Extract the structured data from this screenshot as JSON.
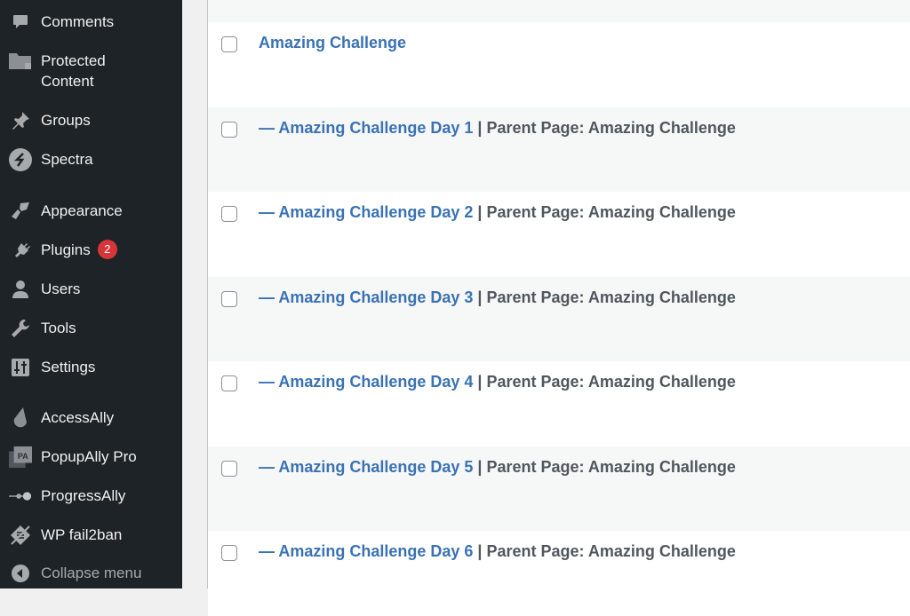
{
  "sidebar": {
    "items": [
      {
        "label": "Comments",
        "icon": "comment-icon"
      },
      {
        "label": "Protected Content",
        "icon": "folder-lock-icon"
      },
      {
        "label": "Groups",
        "icon": "pin-icon"
      },
      {
        "label": "Spectra",
        "icon": "spectra-icon"
      },
      {
        "label": "Appearance",
        "icon": "paintbrush-icon"
      },
      {
        "label": "Plugins",
        "icon": "plug-icon",
        "badge": "2"
      },
      {
        "label": "Users",
        "icon": "user-icon"
      },
      {
        "label": "Tools",
        "icon": "wrench-icon"
      },
      {
        "label": "Settings",
        "icon": "sliders-icon"
      },
      {
        "label": "AccessAlly",
        "icon": "accessally-icon"
      },
      {
        "label": "PopupAlly Pro",
        "icon": "popupally-icon"
      },
      {
        "label": "ProgressAlly",
        "icon": "progressally-icon"
      },
      {
        "label": "WP fail2ban",
        "icon": "fail2ban-icon"
      },
      {
        "label": "Collapse menu",
        "icon": "collapse-icon"
      }
    ],
    "badge_color": "#d63638"
  },
  "pages": {
    "rows": [
      {
        "title": "Amazing Challenge",
        "parent": ""
      },
      {
        "title": "— Amazing Challenge Day 1",
        "parent": " | Parent Page: Amazing Challenge"
      },
      {
        "title": "— Amazing Challenge Day 2",
        "parent": " | Parent Page: Amazing Challenge"
      },
      {
        "title": "— Amazing Challenge Day 3",
        "parent": " | Parent Page: Amazing Challenge"
      },
      {
        "title": "— Amazing Challenge Day 4",
        "parent": " | Parent Page: Amazing Challenge"
      },
      {
        "title": "— Amazing Challenge Day 5",
        "parent": " | Parent Page: Amazing Challenge"
      },
      {
        "title": "— Amazing Challenge Day 6",
        "parent": " | Parent Page: Amazing Challenge"
      }
    ],
    "link_color": "#3a72b4"
  }
}
